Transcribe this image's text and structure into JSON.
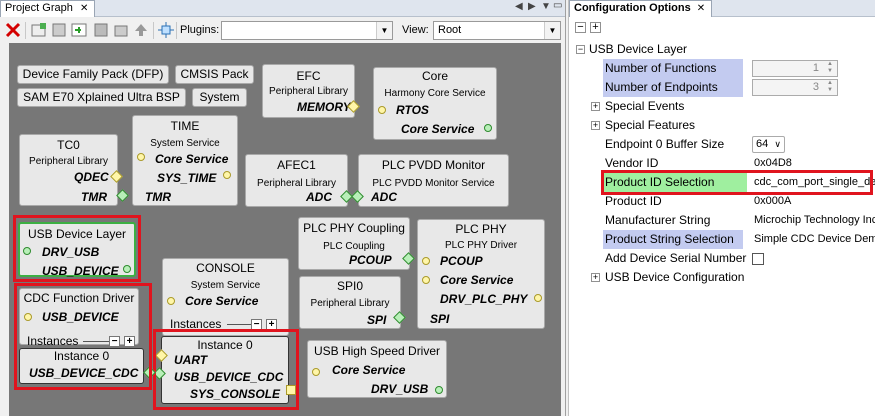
{
  "left_panel": {
    "tab_title": "Project Graph",
    "plugins_label": "Plugins:",
    "plugins_value": "",
    "view_label": "View:",
    "view_value": "Root"
  },
  "graph": {
    "pills": {
      "dfp": "Device Family Pack (DFP)",
      "cmsis": "CMSIS Pack",
      "bsp": "SAM E70 Xplained Ultra BSP",
      "system": "System"
    },
    "efc": {
      "title": "EFC",
      "subtitle": "Peripheral Library",
      "dep1": "MEMORY"
    },
    "core": {
      "title": "Core",
      "subtitle": "Harmony Core Service",
      "dep1": "RTOS",
      "dep2": "Core Service"
    },
    "tc0": {
      "title": "TC0",
      "subtitle": "Peripheral Library",
      "dep1": "QDEC",
      "dep2": "TMR"
    },
    "time": {
      "title": "TIME",
      "subtitle": "System Service",
      "dep1": "Core Service",
      "dep2": "SYS_TIME",
      "dep3": "TMR"
    },
    "afec1": {
      "title": "AFEC1",
      "subtitle": "Peripheral Library",
      "dep1": "ADC"
    },
    "plcpvdd": {
      "title": "PLC PVDD Monitor",
      "subtitle": "PLC PVDD Monitor Service",
      "dep1": "ADC"
    },
    "usbdev": {
      "title": "USB Device Layer",
      "dep1": "DRV_USB",
      "dep2": "USB_DEVICE"
    },
    "plccoupling": {
      "title": "PLC PHY Coupling",
      "subtitle": "PLC Coupling",
      "dep1": "PCOUP"
    },
    "plcphy": {
      "title": "PLC PHY",
      "subtitle": "PLC PHY Driver",
      "dep1": "PCOUP",
      "dep2": "Core Service",
      "dep3": "DRV_PLC_PHY",
      "dep4": "SPI"
    },
    "console": {
      "title": "CONSOLE",
      "subtitle": "System Service",
      "dep1": "Core Service",
      "instances": "Instances",
      "instance0": "Instance 0",
      "dep2": "UART",
      "dep3": "USB_DEVICE_CDC",
      "dep4": "SYS_CONSOLE"
    },
    "spi0": {
      "title": "SPI0",
      "subtitle": "Peripheral Library",
      "dep1": "SPI"
    },
    "cdc": {
      "title": "CDC Function Driver",
      "dep1": "USB_DEVICE",
      "instances": "Instances",
      "instance0": "Instance 0",
      "dep2": "USB_DEVICE_CDC"
    },
    "usbhs": {
      "title": "USB High Speed Driver",
      "dep1": "Core Service",
      "dep2": "DRV_USB"
    }
  },
  "right_panel": {
    "tab_title": "Configuration Options",
    "root": "USB Device Layer",
    "rows": [
      {
        "label": "Number of Functions",
        "value": "1"
      },
      {
        "label": "Number of Endpoints",
        "value": "3"
      },
      {
        "label": "Special Events",
        "value": ""
      },
      {
        "label": "Special Features",
        "value": ""
      },
      {
        "label": "Endpoint 0 Buffer Size",
        "value": "64"
      },
      {
        "label": "Vendor ID",
        "value": "0x04D8"
      },
      {
        "label": "Product ID Selection",
        "value": "cdc_com_port_single_demo"
      },
      {
        "label": "Product ID",
        "value": "0x000A"
      },
      {
        "label": "Manufacturer String",
        "value": "Microchip Technology Inc."
      },
      {
        "label": "Product String Selection",
        "value": "Simple CDC Device Demo"
      },
      {
        "label": "Add Device Serial Number",
        "value": ""
      },
      {
        "label": "USB Device Configuration",
        "value": ""
      }
    ]
  },
  "colors": {
    "canvas": "#777777",
    "highlight": "#c3cbf0",
    "red_outline": "#e0141e"
  }
}
